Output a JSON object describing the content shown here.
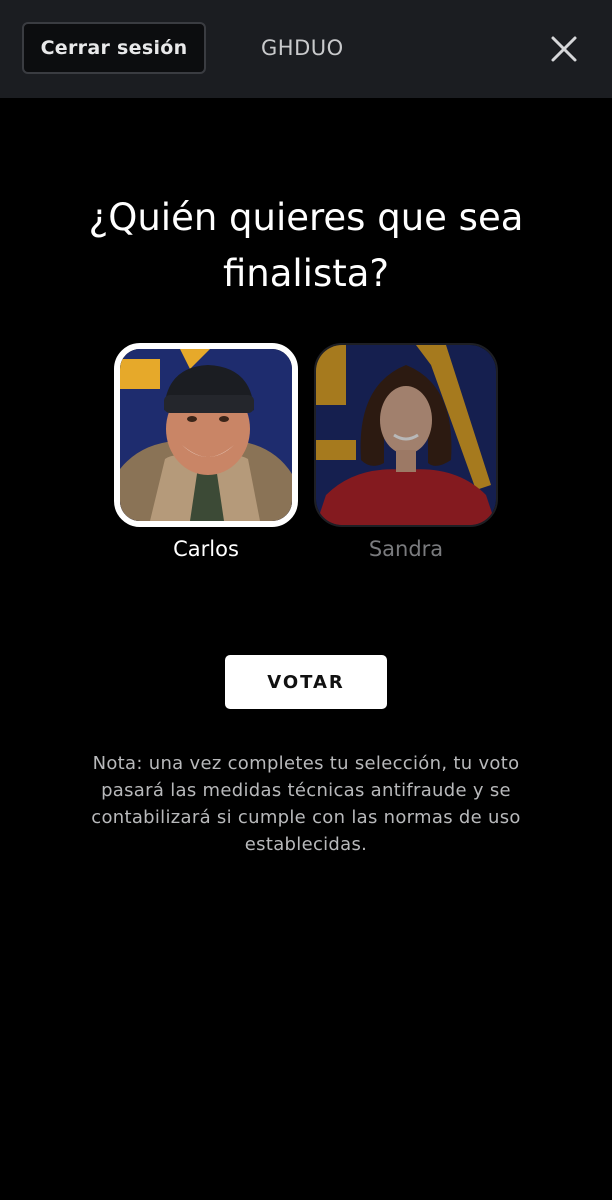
{
  "header": {
    "logout_label": "Cerrar sesión",
    "brand": "GHDUO",
    "close_icon": "close-icon"
  },
  "main": {
    "question_lines": [
      "¿Quién quieres que sea",
      "finalista?"
    ],
    "candidates": [
      {
        "name": "Carlos",
        "selected": true,
        "photo": "carlos-photo"
      },
      {
        "name": "Sandra",
        "selected": false,
        "photo": "sandra-photo"
      }
    ],
    "vote_label": "VOTAR",
    "note_lines": [
      "Nota: una vez completes tu selección, tu voto",
      "pasará las medidas técnicas antifraude y se",
      "contabilizará si cumple con las normas de uso",
      "establecidas."
    ]
  },
  "colors": {
    "background": "#000000",
    "topbar": "#1b1d21",
    "photo_bg_blue": "#1e2c6e",
    "photo_accent_yellow": "#e6a92a"
  }
}
